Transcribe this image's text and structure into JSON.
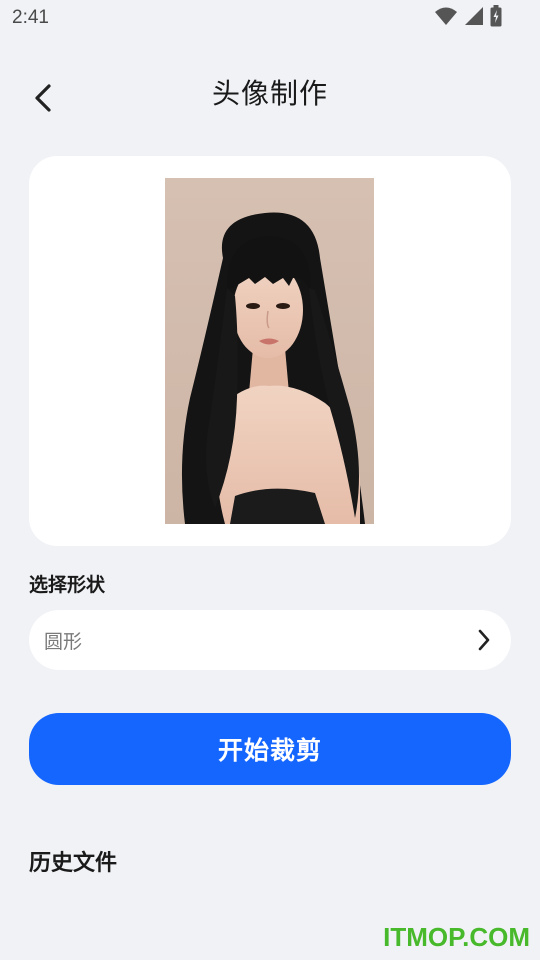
{
  "status_bar": {
    "time": "2:41",
    "icons": [
      "wifi-icon",
      "cellular-signal-icon",
      "battery-charging-icon"
    ]
  },
  "header": {
    "back_icon": "chevron-left-icon",
    "title": "头像制作"
  },
  "preview": {
    "image_description": "portrait-photo"
  },
  "shape_section": {
    "label": "选择形状",
    "selected_value": "圆形",
    "chevron_icon": "chevron-right-icon"
  },
  "actions": {
    "start_crop_label": "开始裁剪"
  },
  "history": {
    "title": "历史文件"
  },
  "watermark": {
    "text": "ITMOP.COM"
  },
  "colors": {
    "background": "#f0f2f6",
    "card": "#ffffff",
    "primary_button": "#1566ff",
    "watermark": "#47b92b"
  }
}
